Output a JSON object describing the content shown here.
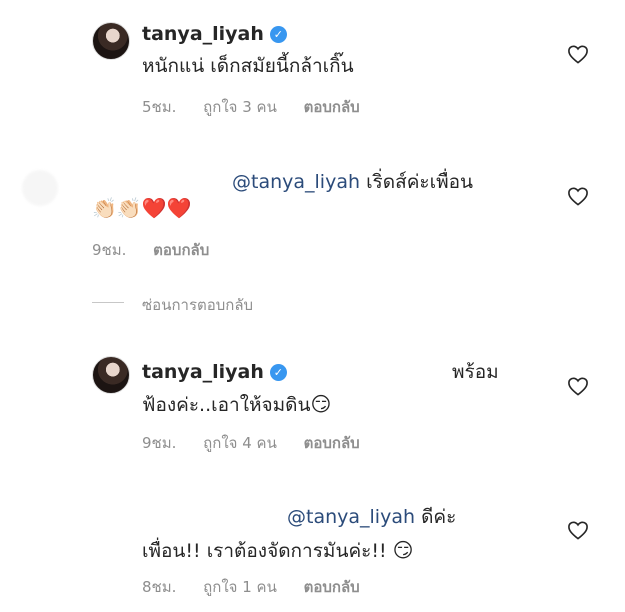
{
  "comments": [
    {
      "username": "tanya_liyah",
      "verified": true,
      "text_line1": "หนักแน่ เด็กสมัยนี้กล้าเกิ๊น",
      "time": "5ชม.",
      "likes": "ถูกใจ 3 คน",
      "reply": "ตอบกลับ"
    },
    {
      "mention": "@tanya_liyah",
      "text_line1": "เริ่ดส์ค่ะเพื่อน",
      "emojis": "👏🏻👏🏻❤️❤️",
      "time": "9ชม.",
      "reply": "ตอบกลับ"
    },
    {
      "username": "tanya_liyah",
      "verified": true,
      "text_line1": "พร้อม",
      "text_line2": "ฟ้องค่ะ..เอาให้จมดิน",
      "emoji": "😏",
      "time": "9ชม.",
      "likes": "ถูกใจ 4 คน",
      "reply": "ตอบกลับ"
    },
    {
      "mention": "@tanya_liyah",
      "text_line1": "ดีค่ะ",
      "text_line2": "เพื่อน!! เราต้องจัดการมันค่ะ!!",
      "emoji": "😏",
      "time": "8ชม.",
      "likes": "ถูกใจ 1 คน",
      "reply": "ตอบกลับ"
    }
  ],
  "hide_replies": "ซ่อนการตอบกลับ",
  "verified_mark": "✓",
  "icons": {
    "like": "heart-outline-icon",
    "verified": "verified-badge-icon"
  },
  "colors": {
    "mention": "#2b4b7a",
    "meta": "#8e8e8e",
    "verified": "#3897f0"
  }
}
